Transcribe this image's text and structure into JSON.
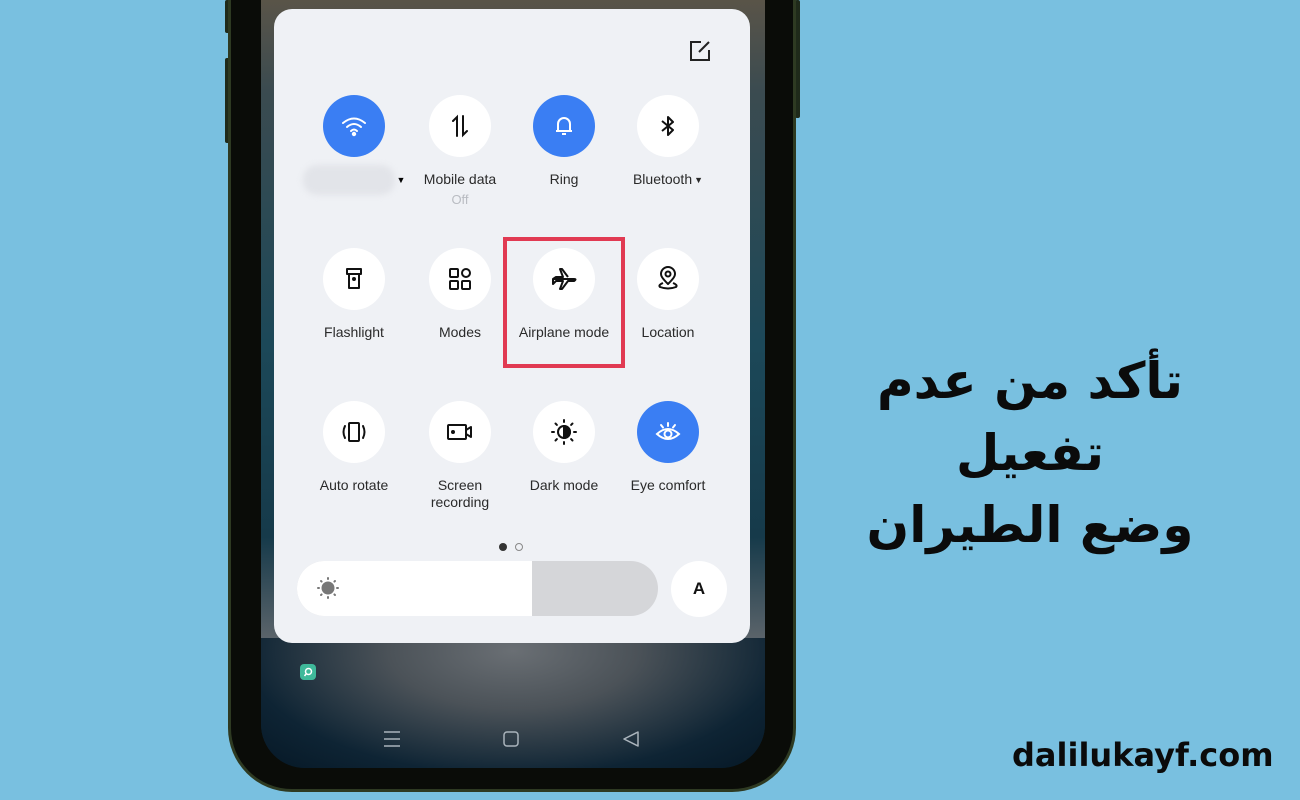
{
  "quick_settings": {
    "edit_icon": "edit-icon",
    "tiles": [
      {
        "id": "wifi",
        "label": "",
        "label_redacted": true,
        "has_dropdown": true,
        "active": true,
        "icon": "wifi-icon"
      },
      {
        "id": "mobile-data",
        "label": "Mobile data",
        "sublabel": "Off",
        "active": false,
        "icon": "mobile-data-icon"
      },
      {
        "id": "ring",
        "label": "Ring",
        "active": true,
        "icon": "bell-icon"
      },
      {
        "id": "bluetooth",
        "label": "Bluetooth",
        "has_dropdown": true,
        "active": false,
        "icon": "bluetooth-icon"
      },
      {
        "id": "flashlight",
        "label": "Flashlight",
        "active": false,
        "icon": "flashlight-icon"
      },
      {
        "id": "modes",
        "label": "Modes",
        "active": false,
        "icon": "modes-grid-icon"
      },
      {
        "id": "airplane-mode",
        "label": "Airplane mode",
        "active": false,
        "highlighted": true,
        "icon": "airplane-icon"
      },
      {
        "id": "location",
        "label": "Location",
        "active": false,
        "icon": "location-pin-icon"
      },
      {
        "id": "auto-rotate",
        "label": "Auto rotate",
        "active": false,
        "icon": "auto-rotate-icon"
      },
      {
        "id": "screen-recording",
        "label": "Screen\nrecording",
        "label_line1": "Screen",
        "label_line2": "recording",
        "active": false,
        "icon": "screen-record-icon"
      },
      {
        "id": "dark-mode",
        "label": "Dark mode",
        "active": false,
        "icon": "dark-mode-icon"
      },
      {
        "id": "eye-comfort",
        "label": "Eye comfort",
        "active": true,
        "icon": "eye-icon"
      }
    ],
    "page_indicator": {
      "current": 1,
      "total": 2
    },
    "brightness": {
      "level_percent": 65,
      "icon": "sun-icon"
    },
    "auto_brightness_label": "A"
  },
  "navigation_bar": {
    "buttons": [
      {
        "id": "recents",
        "icon": "menu-lines-icon"
      },
      {
        "id": "home",
        "icon": "home-square-icon"
      },
      {
        "id": "back",
        "icon": "back-triangle-icon"
      }
    ]
  },
  "notification_icon": "chat-bubble-icon",
  "colors": {
    "background": "#79c0e0",
    "active_tile": "#3a7ef3",
    "highlight_box": "#e13a52",
    "panel": "#eff1f5"
  },
  "caption": {
    "headline_line1": "تأكد من عدم تفعيل",
    "headline_line2": "وضع الطيران",
    "website": "dalilukayf.com"
  }
}
